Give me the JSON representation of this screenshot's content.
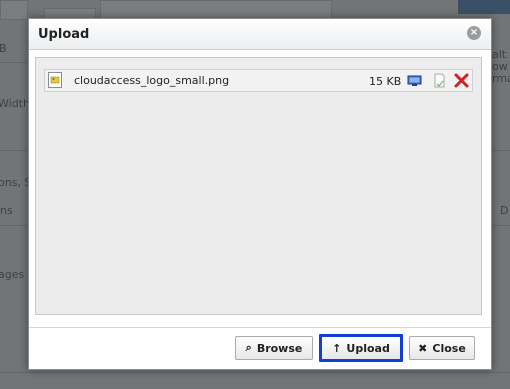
{
  "dialog": {
    "title": "Upload",
    "close_glyph": "×"
  },
  "files": [
    {
      "name": "cloudaccess_logo_small.png",
      "size": "15 KB",
      "icons": [
        "image-file-icon",
        "monitor-icon",
        "document-icon",
        "delete-icon"
      ]
    }
  ],
  "buttons": {
    "browse": {
      "label": "Browse",
      "icon": "search-icon",
      "glyph": "⌕"
    },
    "upload": {
      "label": "Upload",
      "icon": "up-arrow-icon",
      "glyph": "↑"
    },
    "close": {
      "label": "Close",
      "icon": "close-icon",
      "glyph": "✖"
    }
  },
  "background_fragments": [
    "alt a",
    "ow a",
    "rma",
    "Width",
    "ons, S",
    "ns",
    "ages",
    "D",
    "B"
  ],
  "colors": {
    "accent_focus": "#1340d4",
    "delete_red": "#d42020",
    "overlay": "#727476"
  }
}
